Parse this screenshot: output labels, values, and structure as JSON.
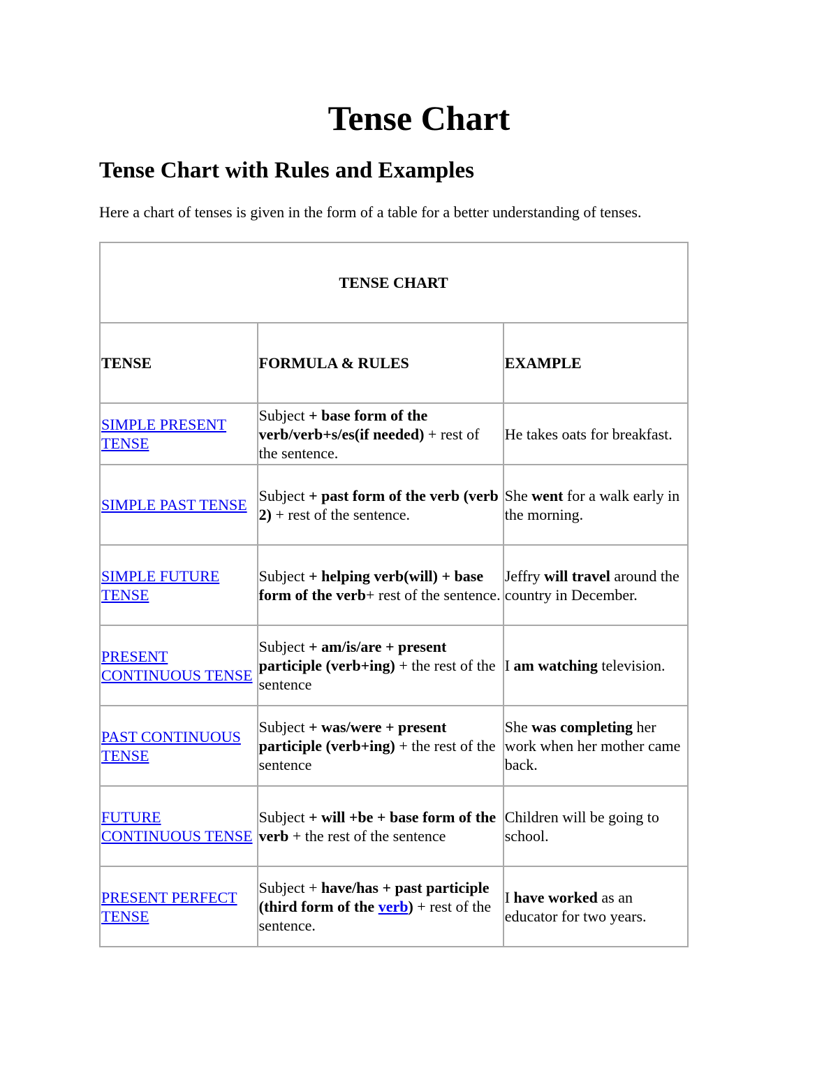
{
  "title": "Tense Chart",
  "subtitle": "Tense Chart with Rules and Examples",
  "intro": "Here a chart of tenses is given in the form of a table for a better understanding of tenses.",
  "table": {
    "caption": "TENSE CHART",
    "headers": [
      "TENSE",
      "FORMULA & RULES",
      "EXAMPLE"
    ],
    "rows": [
      {
        "tense": "SIMPLE PRESENT TENSE",
        "formula": [
          {
            "t": "Subject "
          },
          {
            "t": "+ base form of the verb/verb+s/es(if needed)",
            "b": true
          },
          {
            "t": " + rest of the sentence."
          }
        ],
        "example": [
          {
            "t": "He takes oats for breakfast."
          }
        ]
      },
      {
        "tense": "SIMPLE PAST TENSE",
        "formula": [
          {
            "t": "Subject "
          },
          {
            "t": "+ past form of the verb (verb 2)",
            "b": true
          },
          {
            "t": " + rest of the sentence."
          }
        ],
        "example": [
          {
            "t": "She "
          },
          {
            "t": "went",
            "b": true
          },
          {
            "t": " for a walk early in the morning."
          }
        ]
      },
      {
        "tense": "SIMPLE FUTURE TENSE",
        "formula": [
          {
            "t": "Subject "
          },
          {
            "t": "+ helping verb(will) + base form of the verb",
            "b": true
          },
          {
            "t": "+ rest of the sentence."
          }
        ],
        "example": [
          {
            "t": "Jeffry "
          },
          {
            "t": "will travel",
            "b": true
          },
          {
            "t": " around the country in December."
          }
        ]
      },
      {
        "tense": "PRESENT CONTINUOUS TENSE",
        "formula": [
          {
            "t": "Subject "
          },
          {
            "t": "+ am/is/are + present participle (verb+ing)",
            "b": true
          },
          {
            "t": " + the rest of the sentence"
          }
        ],
        "example": [
          {
            "t": "I "
          },
          {
            "t": "am watching",
            "b": true
          },
          {
            "t": " television."
          }
        ]
      },
      {
        "tense": "PAST CONTINUOUS TENSE",
        "formula": [
          {
            "t": "Subject "
          },
          {
            "t": "+ was/were + present participle (verb+ing)",
            "b": true
          },
          {
            "t": " + the rest of the sentence"
          }
        ],
        "example": [
          {
            "t": "She "
          },
          {
            "t": "was completing",
            "b": true
          },
          {
            "t": " her work when her mother came back."
          }
        ]
      },
      {
        "tense": "FUTURE CONTINUOUS TENSE",
        "formula": [
          {
            "t": "Subject "
          },
          {
            "t": "+ will +be + base form of the verb",
            "b": true
          },
          {
            "t": " + the rest of the sentence"
          }
        ],
        "example": [
          {
            "t": "Children will be going to school."
          }
        ]
      },
      {
        "tense": "PRESENT PERFECT TENSE",
        "formula": [
          {
            "t": "Subject + "
          },
          {
            "t": "have/has + past participle (third form of the ",
            "b": true
          },
          {
            "t": "verb",
            "b": true,
            "link": true
          },
          {
            "t": ")",
            "b": true
          },
          {
            "t": " + rest of the sentence."
          }
        ],
        "example": [
          {
            "t": "I "
          },
          {
            "t": "have worked",
            "b": true
          },
          {
            "t": " as an educator for two years."
          }
        ]
      }
    ]
  }
}
